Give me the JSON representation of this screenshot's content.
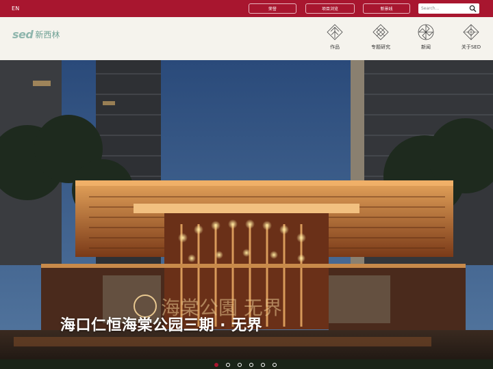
{
  "topbar": {
    "lang": "EN",
    "buttons": [
      "荣誉",
      "项目浏览",
      "新景线"
    ],
    "search_placeholder": "Search..."
  },
  "logo": {
    "latin": "sed",
    "chinese": "新西林"
  },
  "nav": {
    "items": [
      {
        "label": "作品",
        "icon": "works-lotus-icon"
      },
      {
        "label": "专题研究",
        "icon": "research-diamond-icon"
      },
      {
        "label": "新闻",
        "icon": "news-pinwheel-icon"
      },
      {
        "label": "关于SED",
        "icon": "about-diamond-icon"
      }
    ]
  },
  "hero": {
    "caption": "海口仁恒海棠公园三期 · 无界",
    "sign_text": "海棠公園  无界",
    "slides": 6,
    "active_slide": 1
  },
  "colors": {
    "brand_red": "#a8162f",
    "logo_green": "#8fb6ad",
    "nav_bg": "#f5f3ed"
  }
}
